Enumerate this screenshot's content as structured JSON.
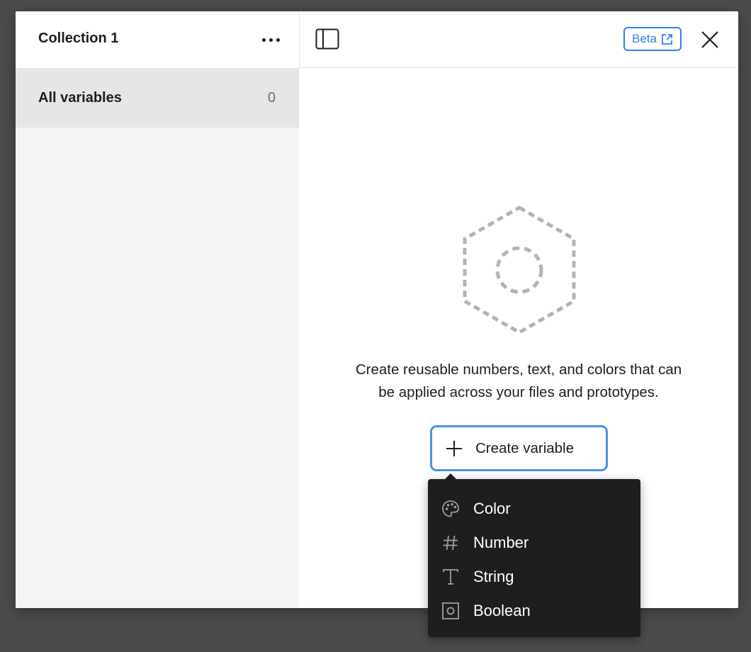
{
  "sidebar": {
    "collection_title": "Collection 1",
    "items": [
      {
        "label": "All variables",
        "count": "0"
      }
    ]
  },
  "header": {
    "beta_label": "Beta"
  },
  "empty_state": {
    "message_line1": "Create reusable numbers, text, and colors that can",
    "message_line2": "be applied across your files and prototypes.",
    "create_button_label": "Create variable"
  },
  "dropdown": {
    "items": [
      {
        "label": "Color",
        "icon": "palette-icon"
      },
      {
        "label": "Number",
        "icon": "hash-icon"
      },
      {
        "label": "String",
        "icon": "text-icon"
      },
      {
        "label": "Boolean",
        "icon": "boolean-icon"
      }
    ]
  },
  "colors": {
    "accent": "#2f80ed",
    "sidebar_bg": "#f4f4f4",
    "selected_bg": "#e6e6e6",
    "menu_bg": "#1e1e1e"
  }
}
